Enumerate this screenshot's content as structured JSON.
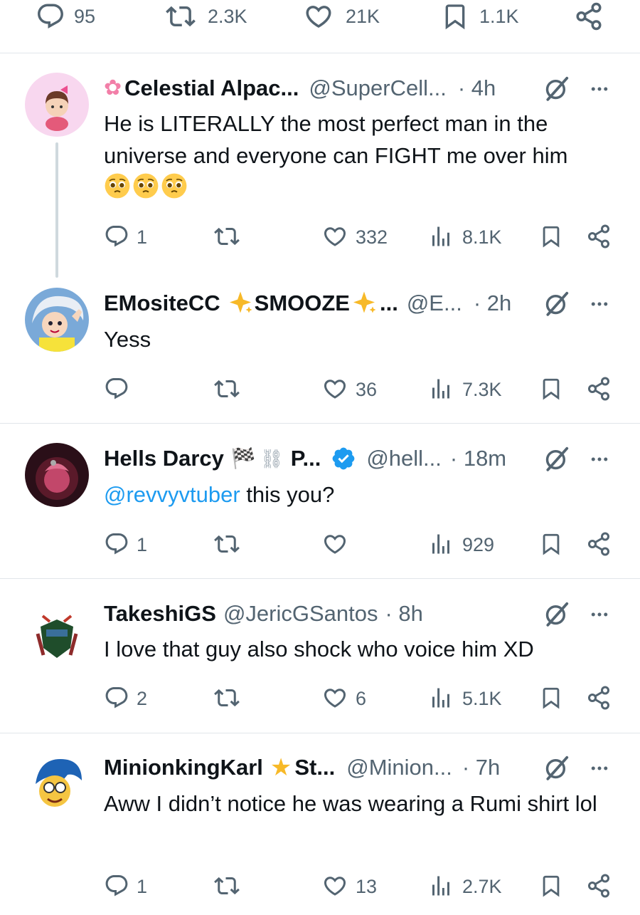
{
  "top_actions": {
    "replies": "95",
    "reposts": "2.3K",
    "likes": "21K",
    "bookmarks": "1.1K"
  },
  "tweets": [
    {
      "name": "Celestial Alpac...",
      "handle": "@SuperCell...",
      "time": "· 4h",
      "text": "He is LITERALLY the most perfect man in the universe and everyone can FIGHT me over him",
      "replies": "1",
      "reposts": "",
      "likes": "332",
      "views": "8.1K"
    },
    {
      "name": "EMositeCC",
      "name_suffix": "SMOOZE",
      "name_ellipsis": "...",
      "handle": "@E...",
      "time": "· 2h",
      "text": "Yess",
      "replies": "",
      "reposts": "",
      "likes": "36",
      "views": "7.3K"
    },
    {
      "name": "Hells Darcy",
      "name_suffix": "P...",
      "handle": "@hell...",
      "time": "· 18m",
      "mention": "@revvyvtuber",
      "text": " this you?",
      "replies": "1",
      "reposts": "",
      "likes": "",
      "views": "929"
    },
    {
      "name": "TakeshiGS",
      "handle": "@JericGSantos",
      "time": "· 8h",
      "text": "I love that guy also shock who voice him XD",
      "replies": "2",
      "reposts": "",
      "likes": "6",
      "views": "5.1K"
    },
    {
      "name": "MinionkingKarl",
      "name_suffix": "St...",
      "handle": "@Minion...",
      "time": "· 7h",
      "text": "Aww I didn’t notice he was wearing a Rumi shirt lol",
      "replies": "1",
      "reposts": "",
      "likes": "13",
      "views": "2.7K"
    }
  ],
  "colors": {
    "text": "#0f1419",
    "muted": "#536471",
    "link": "#1d9bf0",
    "verified": "#1d9bf0",
    "separator": "#e1e6ea"
  },
  "icons": [
    "reply-icon",
    "repost-icon",
    "like-icon",
    "bookmark-icon",
    "share-icon",
    "views-icon",
    "grok-icon",
    "more-icon",
    "verified-icon"
  ]
}
